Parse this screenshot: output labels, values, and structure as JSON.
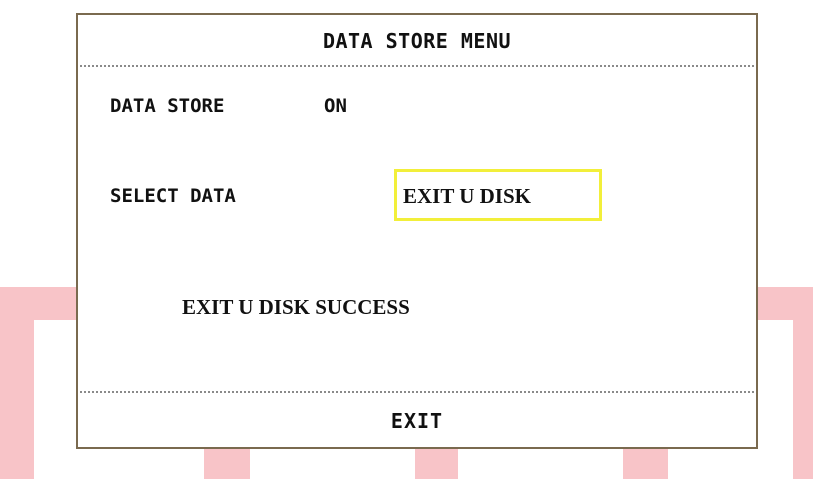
{
  "dialog": {
    "title": "DATA STORE MENU",
    "data_store_label": "DATA STORE",
    "data_store_value": "ON",
    "select_data_label": "SELECT DATA",
    "select_data_value": "EXIT U DISK",
    "status_message": "EXIT U DISK  SUCCESS",
    "exit_label": "EXIT"
  },
  "colors": {
    "border": "#7a6a4f",
    "selection_highlight": "#f2ef3a",
    "watermark": "#f8c4c8"
  }
}
